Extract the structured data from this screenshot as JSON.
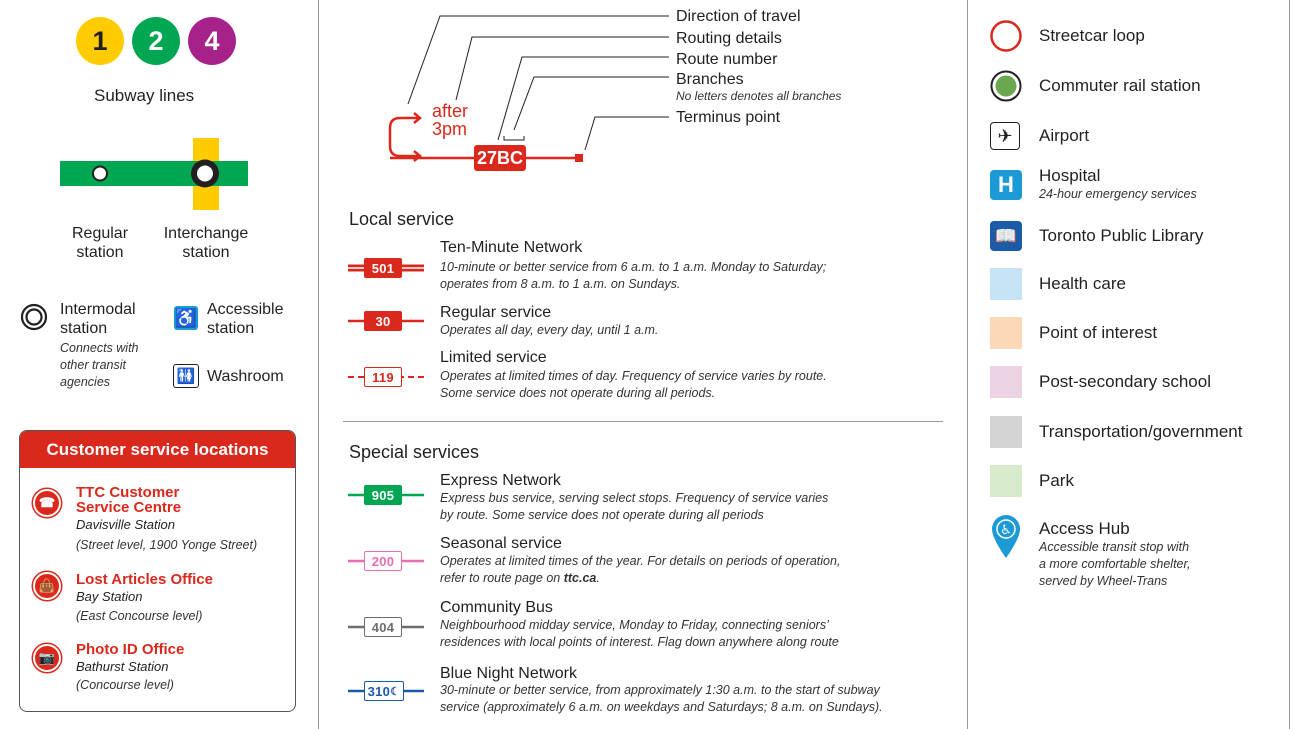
{
  "subway": {
    "lines": [
      {
        "num": "1",
        "color": "#ffcc00",
        "text_color": "#231f20"
      },
      {
        "num": "2",
        "color": "#00a651",
        "text_color": "#ffffff"
      },
      {
        "num": "4",
        "color": "#a6218a",
        "text_color": "#ffffff"
      }
    ],
    "title": "Subway lines",
    "regular": "Regular station",
    "regular_l1": "Regular",
    "regular_l2": "station",
    "interchange_l1": "Interchange",
    "interchange_l2": "station"
  },
  "stations": {
    "intermodal_l1": "Intermodal",
    "intermodal_l2": "station",
    "intermodal_note_l1": "Connects with",
    "intermodal_note_l2": "other transit",
    "intermodal_note_l3": "agencies",
    "accessible_l1": "Accessible",
    "accessible_l2": "station",
    "washroom": "Washroom"
  },
  "customer_service": {
    "header": "Customer service locations",
    "items": [
      {
        "title_l1": "TTC Customer",
        "title_l2": "Service Centre",
        "sub": "Davisville Station",
        "detail": "(Street level, 1900 Yonge Street)",
        "icon": "customer-service-icon"
      },
      {
        "title_l1": "Lost Articles Office",
        "title_l2": "",
        "sub": "Bay Station",
        "detail": "(East Concourse level)",
        "icon": "lost-articles-icon"
      },
      {
        "title_l1": "Photo ID Office",
        "title_l2": "",
        "sub": "Bathurst Station",
        "detail": "(Concourse level)",
        "icon": "camera-icon"
      }
    ]
  },
  "route_diagram": {
    "after_l1": "after",
    "after_l2": "3pm",
    "route_badge": "27BC",
    "labels": {
      "direction": "Direction of travel",
      "routing": "Routing details",
      "route_number": "Route number",
      "branches": "Branches",
      "branches_note": "No letters denotes all branches",
      "terminus": "Terminus point"
    }
  },
  "local_service": {
    "heading": "Local service",
    "items": [
      {
        "badge": "501",
        "title": "Ten-Minute Network",
        "desc_l1": "10-minute or better service from 6 a.m. to 1 a.m. Monday to Saturday;",
        "desc_l2": "operates from 8 a.m. to 1 a.m. on Sundays."
      },
      {
        "badge": "30",
        "title": "Regular service",
        "desc_l1": "Operates all day, every day, until 1 a.m.",
        "desc_l2": ""
      },
      {
        "badge": "119",
        "title": "Limited service",
        "desc_l1": "Operates at limited times of day. Frequency of service varies by route.",
        "desc_l2": "Some service does not operate during all periods."
      }
    ]
  },
  "special_services": {
    "heading": "Special services",
    "items": [
      {
        "badge": "905",
        "title": "Express Network",
        "desc_l1": "Express bus service, serving select stops. Frequency of service varies",
        "desc_l2": "by route. Some service does not operate during all periods"
      },
      {
        "badge": "200",
        "title": "Seasonal service",
        "desc_l1": "Operates at limited times of the year. For details on periods of operation,",
        "desc_l2_pre": "refer to route page on ",
        "desc_l2_link": "ttc.ca",
        "desc_l2_post": "."
      },
      {
        "badge": "404",
        "title": "Community Bus",
        "desc_l1": "Neighbourhood midday service, Monday to Friday, connecting seniors’",
        "desc_l2": "residences with local points of interest. Flag down anywhere along route"
      },
      {
        "badge": "310",
        "title": "Blue Night Network",
        "desc_l1": "30-minute or better service, from approximately 1:30 a.m. to the start of subway",
        "desc_l2": "service (approximately 6 a.m. on weekdays and Saturdays; 8 a.m. on Sundays)."
      }
    ]
  },
  "legend": {
    "streetcar_loop": "Streetcar loop",
    "commuter_rail": "Commuter rail station",
    "airport": "Airport",
    "hospital": "Hospital",
    "hospital_note": "24-hour emergency services",
    "library": "Toronto Public Library",
    "health_care": "Health care",
    "point_of_interest": "Point of interest",
    "post_secondary": "Post-secondary school",
    "transportation": "Transportation/government",
    "park": "Park",
    "access_hub": "Access Hub",
    "access_hub_l1": "Accessible transit stop with",
    "access_hub_l2": "a more comfortable shelter,",
    "access_hub_l3": "served by Wheel-Trans",
    "colors": {
      "health_care": "#c6e2f5",
      "point_of_interest": "#fcd9b6",
      "post_secondary": "#ecd3e3",
      "transportation": "#d4d4d4",
      "park": "#d7ebcb",
      "ttc_red": "#da291c",
      "express_green": "#00a651",
      "seasonal_pink": "#e86fb0",
      "community_grey": "#6d6e71",
      "blue_night": "#1c5ba8"
    }
  }
}
